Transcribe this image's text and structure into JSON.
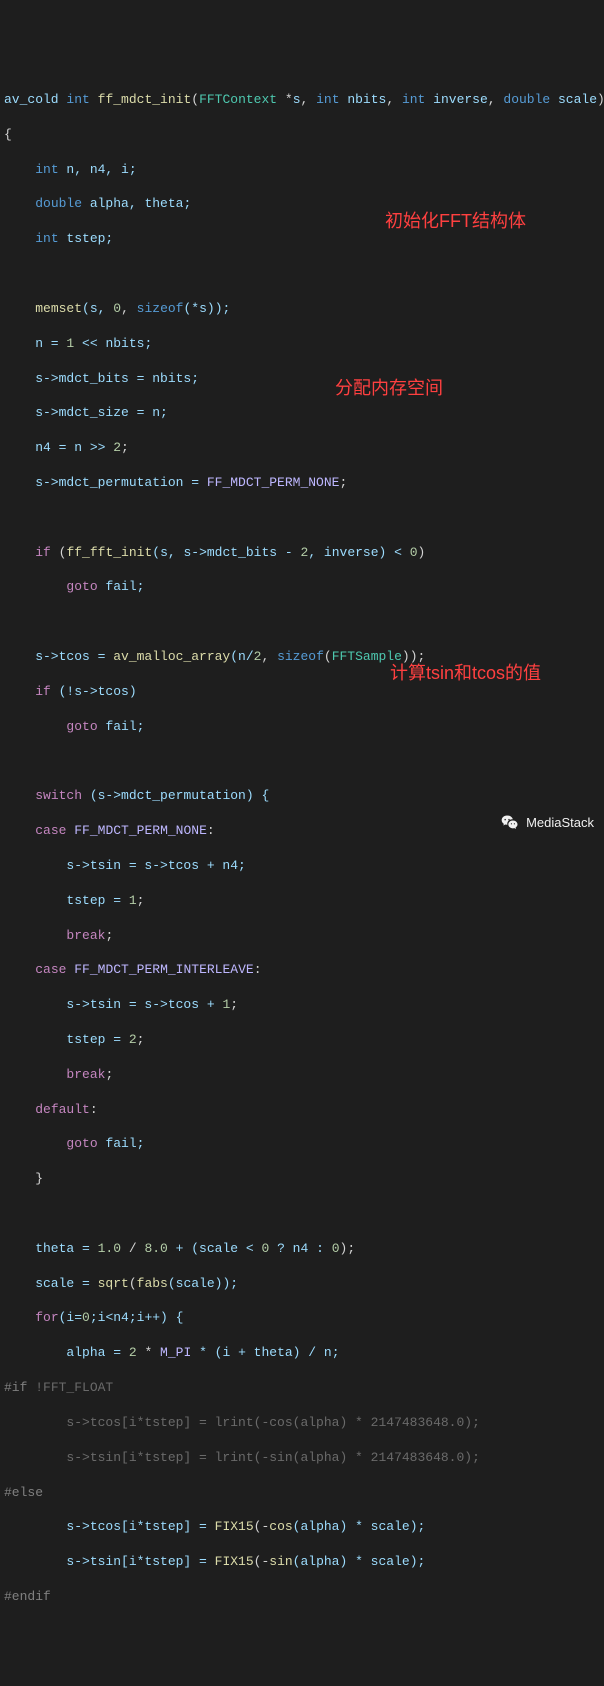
{
  "code": {
    "l1_av": "av_cold",
    "l1_int": "int",
    "l1_fn": "ff_mdct_init",
    "l1_p_open": "(",
    "l1_type": "FFTContext",
    "l1_star_s": " *",
    "l1_s": "s",
    "l1_c1": ", ",
    "l1_int2": "int",
    "l1_nbits": " nbits",
    "l1_c2": ", ",
    "l1_int3": "int",
    "l1_inv": " inverse",
    "l1_c3": ", ",
    "l1_dbl": "double",
    "l1_scale": " scale",
    "l1_p_close": ")",
    "l2": "{",
    "l3a": "    ",
    "l3_int": "int",
    "l3_vars": " n, n4, i;",
    "l4a": "    ",
    "l4_dbl": "double",
    "l4_vars": " alpha, theta;",
    "l5a": "    ",
    "l5_int": "int",
    "l5_vars": " tstep;",
    "l7a": "    ",
    "l7_fn": "memset",
    "l7_rest": "(s, ",
    "l7_0": "0",
    "l7_c": ", ",
    "l7_sizeof": "sizeof",
    "l7_rest2": "(*s));",
    "l8": "    n = ",
    "l8_1": "1",
    "l8_shift": " << nbits;",
    "l9": "    s->mdct_bits = nbits;",
    "l10": "    s->mdct_size = n;",
    "l11": "    n4 = n >> ",
    "l11_2": "2",
    "l11_semi": ";",
    "l12": "    s->mdct_permutation = ",
    "l12_macro": "FF_MDCT_PERM_NONE",
    "l12_semi": ";",
    "l14a": "    ",
    "l14_if": "if",
    "l14_open": " (",
    "l14_fn": "ff_fft_init",
    "l14_args": "(s, s->mdct_bits - ",
    "l14_2": "2",
    "l14_rest": ", inverse) < ",
    "l14_0": "0",
    "l14_close": ")",
    "l15a": "        ",
    "l15_goto": "goto",
    "l15_rest": " fail;",
    "l17": "    s->tcos = ",
    "l17_fn": "av_malloc_array",
    "l17_open": "(n/",
    "l17_2": "2",
    "l17_c": ", ",
    "l17_sizeof": "sizeof",
    "l17_open2": "(",
    "l17_type": "FFTSample",
    "l17_close": "));",
    "l18a": "    ",
    "l18_if": "if",
    "l18_rest": " (!s->tcos)",
    "l19a": "        ",
    "l19_goto": "goto",
    "l19_rest": " fail;",
    "l21a": "    ",
    "l21_sw": "switch",
    "l21_rest": " (s->mdct_permutation) {",
    "l22a": "    ",
    "l22_case": "case",
    "l22_sp": " ",
    "l22_macro": "FF_MDCT_PERM_NONE",
    "l22_colon": ":",
    "l23": "        s->tsin = s->tcos + n4;",
    "l24": "        tstep = ",
    "l24_1": "1",
    "l24_semi": ";",
    "l25a": "        ",
    "l25_br": "break",
    "l25_semi": ";",
    "l26a": "    ",
    "l26_case": "case",
    "l26_sp": " ",
    "l26_macro": "FF_MDCT_PERM_INTERLEAVE",
    "l26_colon": ":",
    "l27": "        s->tsin = s->tcos + ",
    "l27_1": "1",
    "l27_semi": ";",
    "l28": "        tstep = ",
    "l28_2": "2",
    "l28_semi": ";",
    "l29a": "        ",
    "l29_br": "break",
    "l29_semi": ";",
    "l30a": "    ",
    "l30_def": "default",
    "l30_colon": ":",
    "l31a": "        ",
    "l31_goto": "goto",
    "l31_rest": " fail;",
    "l32": "    }",
    "l34": "    theta = ",
    "l34_1": "1.0",
    "l34_div": " / ",
    "l34_8": "8.0",
    "l34_plus": " + (scale < ",
    "l34_0": "0",
    "l34_tern": " ? n4 : ",
    "l34_0b": "0",
    "l34_close": ");",
    "l35": "    scale = ",
    "l35_sqrt": "sqrt",
    "l35_open": "(",
    "l35_fabs": "fabs",
    "l35_rest": "(scale));",
    "l36a": "    ",
    "l36_for": "for",
    "l36_open": "(i=",
    "l36_0": "0",
    "l36_rest": ";i<n4;i++) {",
    "l37": "        alpha = ",
    "l37_2": "2",
    "l37_mul": " * ",
    "l37_mpi": "M_PI",
    "l37_rest": " * (i + theta) / n;",
    "l38_pre": "#if",
    "l38_sp": " !",
    "l38_ff": "FFT_FLOAT",
    "l39": "        s->tcos[i*tstep] = lrint(-cos(alpha) * 2147483648.0);",
    "l40": "        s->tsin[i*tstep] = lrint(-sin(alpha) * 2147483648.0);",
    "l41": "#else",
    "l42": "        s->tcos[i*tstep] = ",
    "l42_fn": "FIX15",
    "l42_open": "(-",
    "l42_cos": "cos",
    "l42_rest": "(alpha) * scale);",
    "l43": "        s->tsin[i*tstep] = ",
    "l43_fn": "FIX15",
    "l43_open": "(-",
    "l43_sin": "sin",
    "l43_rest": "(alpha) * scale);",
    "l44": "#endif"
  },
  "annotations": {
    "a1": "初始化FFT结构体",
    "a2": "分配内存空间",
    "a3": "计算tsin和tcos的值"
  },
  "watermark": {
    "text": "MediaStack"
  }
}
